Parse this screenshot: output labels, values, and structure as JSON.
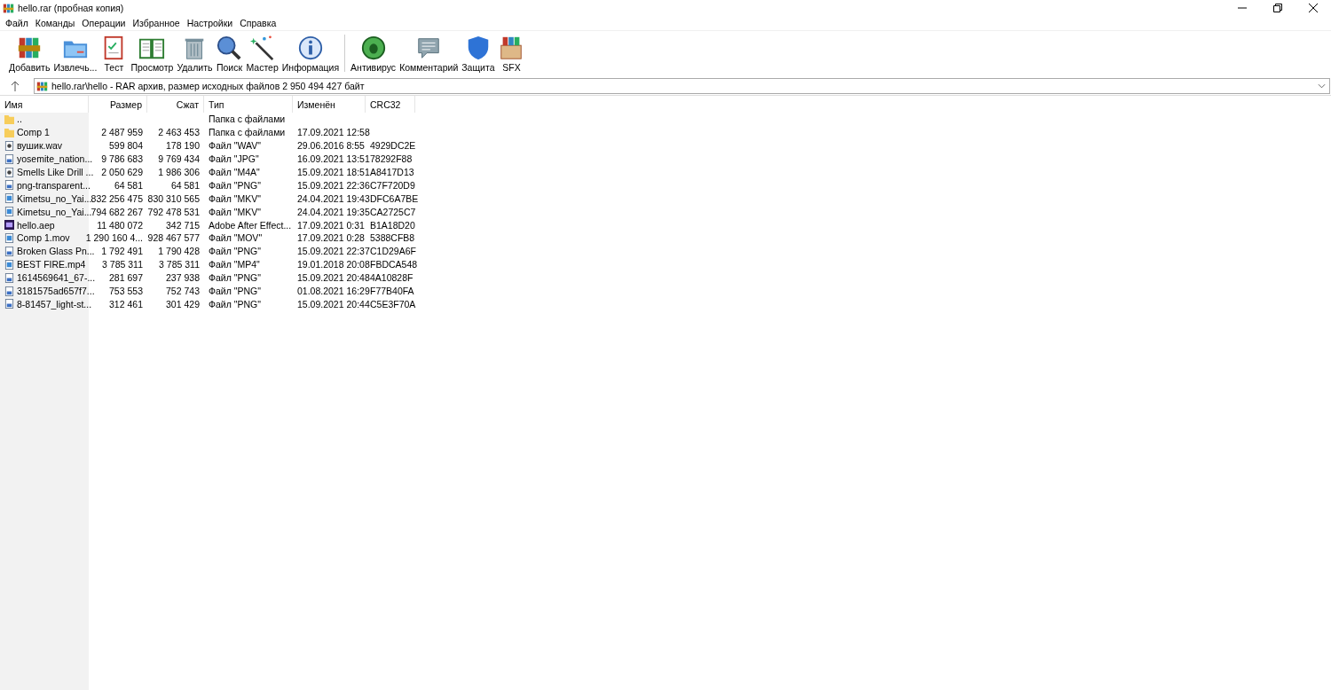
{
  "window": {
    "title": "hello.rar (пробная копия)"
  },
  "menu": [
    "Файл",
    "Команды",
    "Операции",
    "Избранное",
    "Настройки",
    "Справка"
  ],
  "toolbar": [
    {
      "kind": "add",
      "label": "Добавить"
    },
    {
      "kind": "extract",
      "label": "Извлечь..."
    },
    {
      "kind": "test",
      "label": "Тест"
    },
    {
      "kind": "view",
      "label": "Просмотр"
    },
    {
      "kind": "delete",
      "label": "Удалить"
    },
    {
      "kind": "find",
      "label": "Поиск"
    },
    {
      "kind": "wizard",
      "label": "Мастер"
    },
    {
      "kind": "info",
      "label": "Информация"
    },
    {
      "kind": "separator"
    },
    {
      "kind": "virus",
      "label": "Антивирус"
    },
    {
      "kind": "comment",
      "label": "Комментарий"
    },
    {
      "kind": "protect",
      "label": "Защита"
    },
    {
      "kind": "sfx",
      "label": "SFX"
    }
  ],
  "path": "hello.rar\\hello - RAR архив, размер исходных файлов 2 950 494 427 байт",
  "table": {
    "columns": [
      "Имя",
      "Размер",
      "Сжат",
      "Тип",
      "Изменён",
      "CRC32"
    ],
    "rows": [
      {
        "kind": "folder",
        "name": "..",
        "size": "",
        "packed": "",
        "type": "Папка с файлами",
        "modified": "",
        "crc": ""
      },
      {
        "kind": "folder",
        "name": "Comp 1",
        "size": "2 487 959",
        "packed": "2 463 453",
        "type": "Папка с файлами",
        "modified": "17.09.2021 12:58",
        "crc": ""
      },
      {
        "kind": "audio",
        "name": "вушик.wav",
        "size": "599 804",
        "packed": "178 190",
        "type": "Файл \"WAV\"",
        "modified": "29.06.2016 8:55",
        "crc": "4929DC2E"
      },
      {
        "kind": "image",
        "name": "yosemite_nation...",
        "size": "9 786 683",
        "packed": "9 769 434",
        "type": "Файл \"JPG\"",
        "modified": "16.09.2021 13:51",
        "crc": "78292F88"
      },
      {
        "kind": "audio",
        "name": "Smells Like Drill ...",
        "size": "2 050 629",
        "packed": "1 986 306",
        "type": "Файл \"M4A\"",
        "modified": "15.09.2021 18:51",
        "crc": "A8417D13"
      },
      {
        "kind": "image",
        "name": "png-transparent...",
        "size": "64 581",
        "packed": "64 581",
        "type": "Файл \"PNG\"",
        "modified": "15.09.2021 22:36",
        "crc": "C7F720D9"
      },
      {
        "kind": "video",
        "name": "Kimetsu_no_Yai...",
        "size": "832 256 475",
        "packed": "830 310 565",
        "type": "Файл \"MKV\"",
        "modified": "24.04.2021 19:43",
        "crc": "DFC6A7BE"
      },
      {
        "kind": "video",
        "name": "Kimetsu_no_Yai...",
        "size": "794 682 267",
        "packed": "792 478 531",
        "type": "Файл \"MKV\"",
        "modified": "24.04.2021 19:35",
        "crc": "CA2725C7"
      },
      {
        "kind": "aep",
        "name": "hello.aep",
        "size": "11 480 072",
        "packed": "342 715",
        "type": "Adobe After Effect...",
        "modified": "17.09.2021 0:31",
        "crc": "B1A18D20"
      },
      {
        "kind": "video",
        "name": "Comp 1.mov",
        "size": "1 290 160 4...",
        "packed": "928 467 577",
        "type": "Файл \"MOV\"",
        "modified": "17.09.2021 0:28",
        "crc": "5388CFB8"
      },
      {
        "kind": "image",
        "name": "Broken Glass Pn...",
        "size": "1 792 491",
        "packed": "1 790 428",
        "type": "Файл \"PNG\"",
        "modified": "15.09.2021 22:37",
        "crc": "C1D29A6F"
      },
      {
        "kind": "video",
        "name": "BEST FIRE.mp4",
        "size": "3 785 311",
        "packed": "3 785 311",
        "type": "Файл \"MP4\"",
        "modified": "19.01.2018 20:08",
        "crc": "FBDCA548"
      },
      {
        "kind": "image",
        "name": "1614569641_67-...",
        "size": "281 697",
        "packed": "237 938",
        "type": "Файл \"PNG\"",
        "modified": "15.09.2021 20:48",
        "crc": "4A10828F"
      },
      {
        "kind": "image",
        "name": "3181575ad657f7...",
        "size": "753 553",
        "packed": "752 743",
        "type": "Файл \"PNG\"",
        "modified": "01.08.2021 16:29",
        "crc": "F77B40FA"
      },
      {
        "kind": "image",
        "name": "8-81457_light-st...",
        "size": "312 461",
        "packed": "301 429",
        "type": "Файл \"PNG\"",
        "modified": "15.09.2021 20:44",
        "crc": "C5E3F70A"
      }
    ]
  }
}
